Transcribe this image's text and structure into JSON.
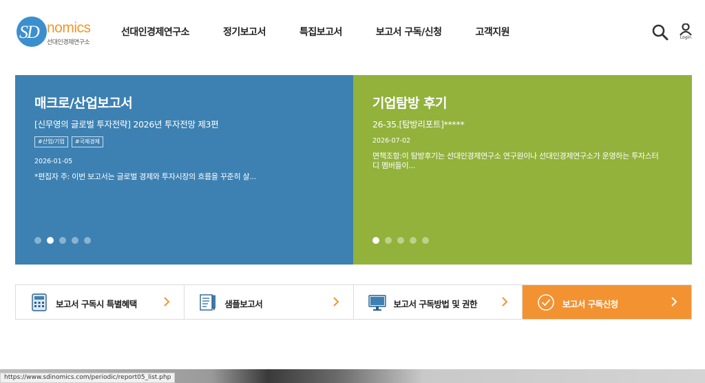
{
  "logo": {
    "mark": "SD",
    "name": "nomics",
    "subtitle": "선대인경제연구소"
  },
  "nav": {
    "items": [
      "선대인경제연구소",
      "정기보고서",
      "특집보고서",
      "보고서 구독/신청",
      "고객지원"
    ],
    "login_label": "Login"
  },
  "panels": {
    "left": {
      "title": "매크로/산업보고서",
      "subtitle": "[신무영의 글로벌 투자전략] 2026년 투자전망 제3편",
      "tags": [
        "#산업/기업",
        "#국제경제"
      ],
      "date": "2026-01-05",
      "desc": "*편집자 주: 이번 보고서는 글로벌 경제와 투자시장의 흐름을 꾸준히 살...",
      "active_dot": 1,
      "dot_count": 5,
      "color": "#3d81b2"
    },
    "right": {
      "title": "기업탐방 후기",
      "subtitle": "26-35.[탐방리포트]*****",
      "date": "2026-07-02",
      "desc": "면책조항:이 탐방후기는 선대인경제연구소 연구원이나 선대인경제연구소가 운영하는 투자스터디 멤버들이...",
      "active_dot": 0,
      "dot_count": 5,
      "color": "#92b23c"
    }
  },
  "quick_links": [
    {
      "label": "보고서 구독시 특별혜택",
      "icon": "calculator-icon"
    },
    {
      "label": "샘플보고서",
      "icon": "document-pen-icon"
    },
    {
      "label": "보고서 구독방법 및 권한",
      "icon": "monitor-icon"
    },
    {
      "label": "보고서 구독신청",
      "icon": "check-circle-icon"
    }
  ],
  "accent_color": "#f39231",
  "status_bar": {
    "url": "https://www.sdinomics.com/periodic/report05_list.php"
  }
}
